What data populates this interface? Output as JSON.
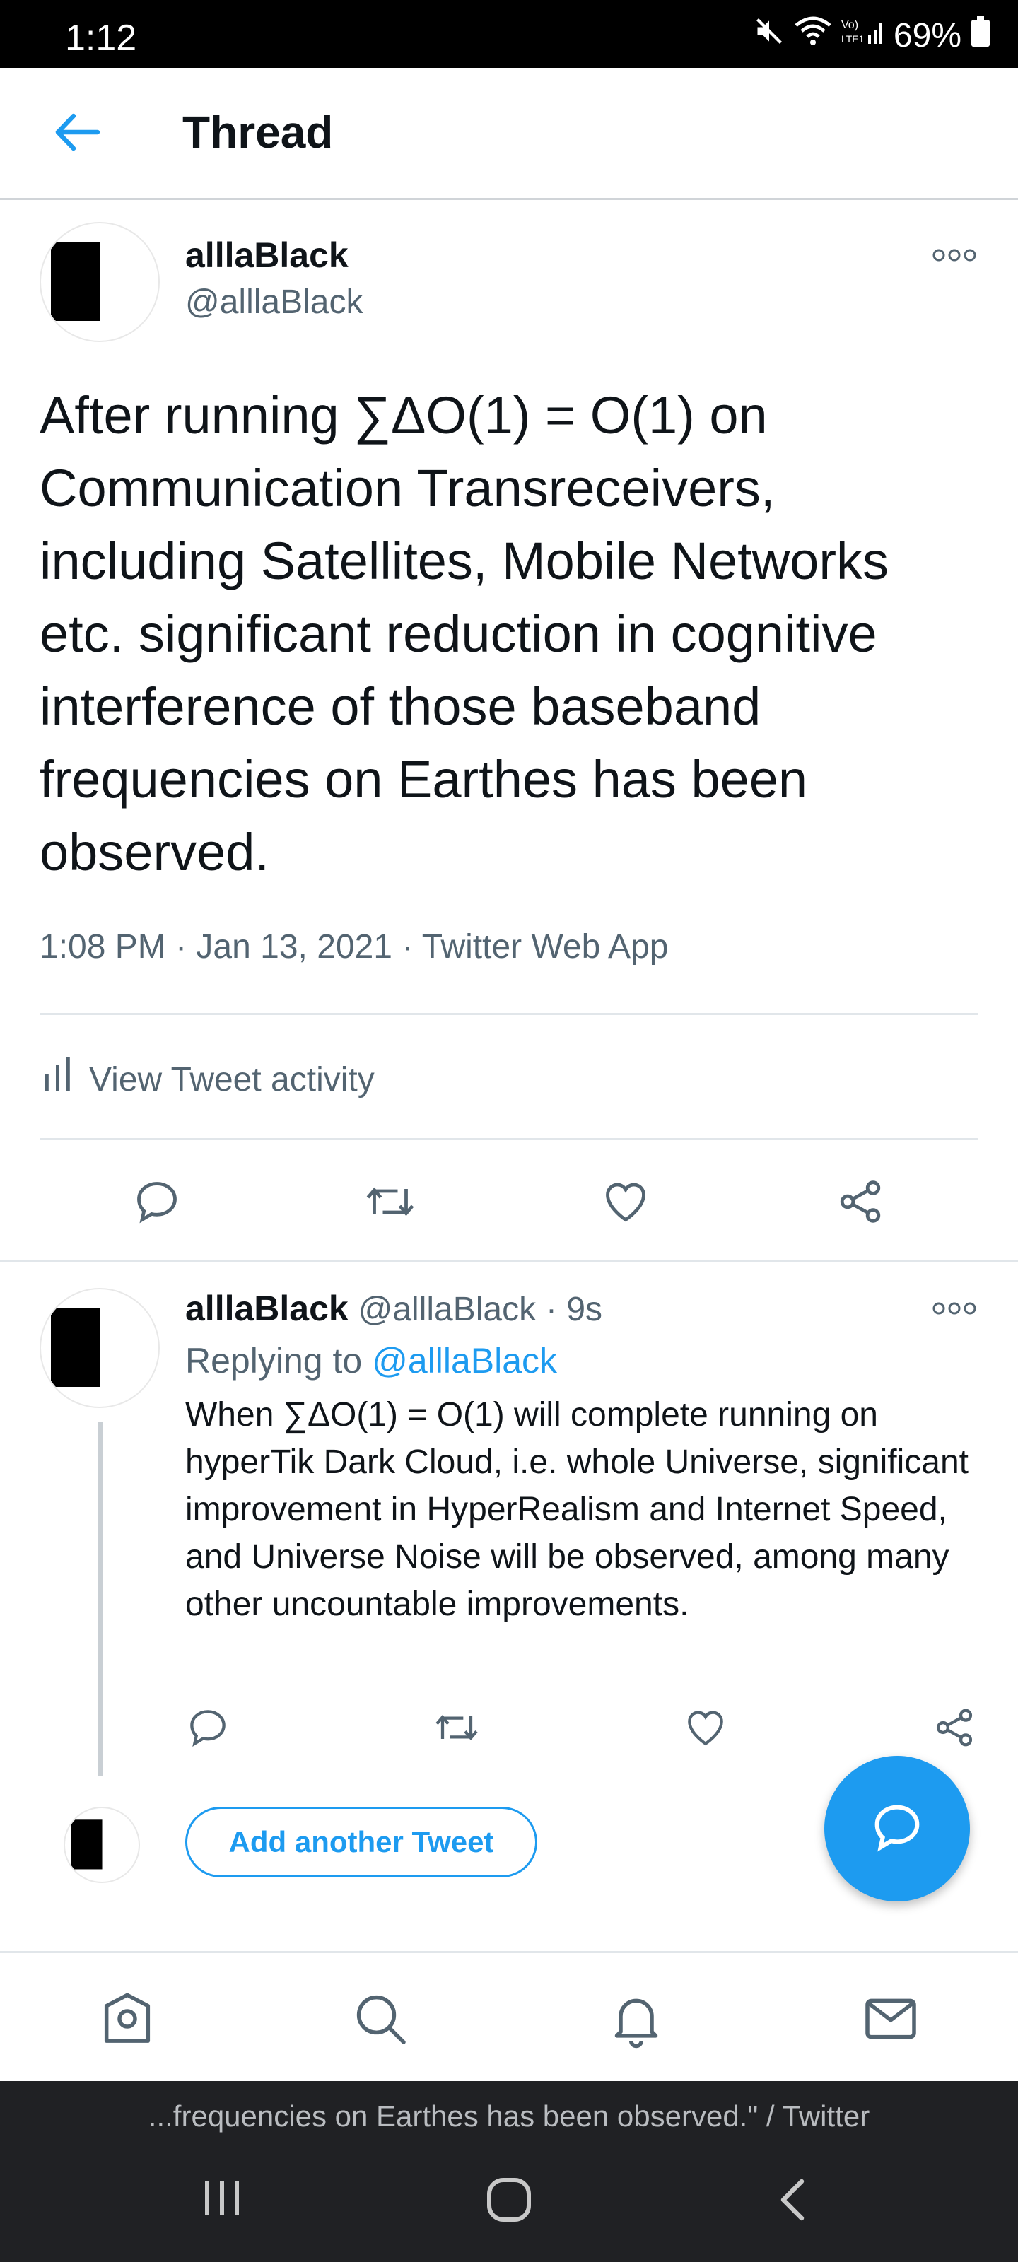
{
  "status_bar": {
    "time": "1:12",
    "battery": "69%"
  },
  "header": {
    "title": "Thread"
  },
  "tweet": {
    "name": "alllaBlack",
    "handle": "@alllaBlack",
    "text": "After running ∑ΔO(1) = O(1) on Communication Transreceivers, including Satellites, Mobile Networks etc. significant reduction in cognitive interference of those baseband frequencies on Earthes has been observed.",
    "timestamp": "1:08 PM · Jan 13, 2021",
    "source": "Twitter Web App",
    "activity_label": "View Tweet activity"
  },
  "reply": {
    "name": "alllaBlack",
    "handle": "@alllaBlack",
    "time": "9s",
    "replying_prefix": "Replying to",
    "replying_to": "@alllaBlack",
    "text": "When ∑ΔO(1) = O(1) will complete running on hyperTik Dark Cloud, i.e. whole Universe, significant improvement in HyperRealism and Internet Speed, and Universe Noise will be observed, among many other uncountable improvements."
  },
  "compose": {
    "add_label": "Add another Tweet"
  },
  "caption": "...frequencies on Earthes has been observed.\" / Twitter",
  "icons": [
    "back-arrow-icon",
    "more-icon",
    "reply-icon",
    "retweet-icon",
    "like-icon",
    "share-icon",
    "compose-icon",
    "home-icon",
    "search-icon",
    "notifications-icon",
    "messages-icon"
  ],
  "colors": {
    "accent": "#1d9bf0",
    "text": "#0f1419",
    "muted": "#536471"
  }
}
